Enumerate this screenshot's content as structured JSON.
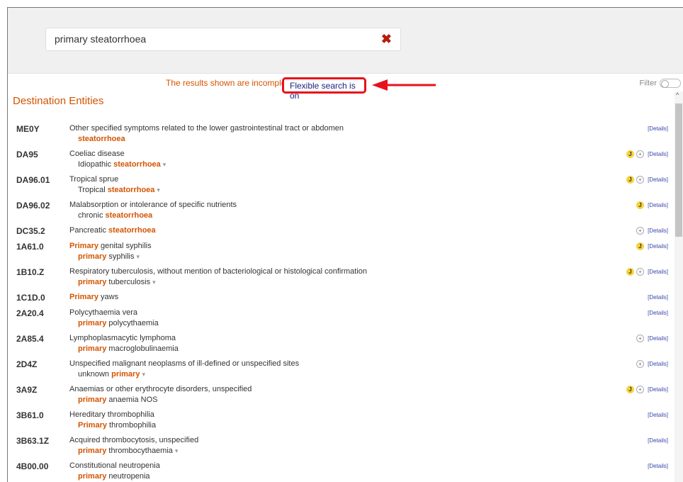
{
  "search": {
    "value": "primary steatorrhoea",
    "clear_icon": "close-x-icon"
  },
  "notice": {
    "incomplete": "The results shown are incomplete",
    "flexible": "Flexible search is on"
  },
  "filter": {
    "label": "Filter"
  },
  "section": {
    "title": "Destination Entities"
  },
  "details_label": "[Details]",
  "colors": {
    "accent": "#d35400",
    "link": "#1a237e",
    "annotation": "#e8101b",
    "badge": "#f5d33c"
  },
  "rows": [
    {
      "code": "ME0Y",
      "title": "Other specified symptoms related to the lower gastrointestinal tract or abdomen",
      "sub_pre": "",
      "sub_hl": "steatorrhoea",
      "sub_post": "",
      "caret": false,
      "j": false,
      "plus": false
    },
    {
      "code": "DA95",
      "title": "Coeliac disease",
      "sub_pre": "Idiopathic ",
      "sub_hl": "steatorrhoea",
      "sub_post": "",
      "caret": true,
      "j": true,
      "plus": true
    },
    {
      "code": "DA96.01",
      "title": "Tropical sprue",
      "sub_pre": "Tropical ",
      "sub_hl": "steatorrhoea",
      "sub_post": "",
      "caret": true,
      "j": true,
      "plus": true
    },
    {
      "code": "DA96.02",
      "title": "Malabsorption or intolerance of specific nutrients",
      "sub_pre": "chronic ",
      "sub_hl": "steatorrhoea",
      "sub_post": "",
      "caret": false,
      "j": true,
      "plus": false
    },
    {
      "code": "DC35.2",
      "title_pre": "Pancreatic ",
      "title_hl": "steatorrhoea",
      "title_post": "",
      "single": true,
      "caret": false,
      "j": false,
      "plus": true
    },
    {
      "code": "1A61.0",
      "title_pre": "",
      "title_hl": "Primary",
      "title_post": " genital syphilis",
      "sub_pre": "",
      "sub_hl": "primary",
      "sub_post": " syphilis",
      "caret": true,
      "j": true,
      "plus": false
    },
    {
      "code": "1B10.Z",
      "title": "Respiratory tuberculosis, without mention of bacteriological or histological confirmation",
      "sub_pre": "",
      "sub_hl": "primary",
      "sub_post": " tuberculosis",
      "caret": true,
      "j": true,
      "plus": true
    },
    {
      "code": "1C1D.0",
      "title_pre": "",
      "title_hl": "Primary",
      "title_post": " yaws",
      "single": true,
      "caret": false,
      "j": false,
      "plus": false
    },
    {
      "code": "2A20.4",
      "title": "Polycythaemia vera",
      "sub_pre": "",
      "sub_hl": "primary",
      "sub_post": " polycythaemia",
      "caret": false,
      "j": false,
      "plus": false
    },
    {
      "code": "2A85.4",
      "title": "Lymphoplasmacytic lymphoma",
      "sub_pre": "",
      "sub_hl": "primary",
      "sub_post": " macroglobulinaemia",
      "caret": false,
      "j": false,
      "plus": true
    },
    {
      "code": "2D4Z",
      "title": "Unspecified malignant neoplasms of ill-defined or unspecified sites",
      "sub_pre": "unknown ",
      "sub_hl": "primary",
      "sub_post": "",
      "caret": true,
      "j": false,
      "plus": true
    },
    {
      "code": "3A9Z",
      "title": "Anaemias or other erythrocyte disorders, unspecified",
      "sub_pre": "",
      "sub_hl": "primary",
      "sub_post": " anaemia NOS",
      "caret": false,
      "j": true,
      "plus": true
    },
    {
      "code": "3B61.0",
      "title": "Hereditary thrombophilia",
      "sub_pre": "",
      "sub_hl": "Primary",
      "sub_post": " thrombophilia",
      "caret": false,
      "j": false,
      "plus": false
    },
    {
      "code": "3B63.1Z",
      "title": "Acquired thrombocytosis, unspecified",
      "sub_pre": "",
      "sub_hl": "primary",
      "sub_post": " thrombocythaemia",
      "caret": true,
      "j": false,
      "plus": false
    },
    {
      "code": "4B00.00",
      "title": "Constitutional neutropenia",
      "sub_pre": "",
      "sub_hl": "primary",
      "sub_post": " neutropenia",
      "caret": false,
      "j": false,
      "plus": false
    }
  ]
}
